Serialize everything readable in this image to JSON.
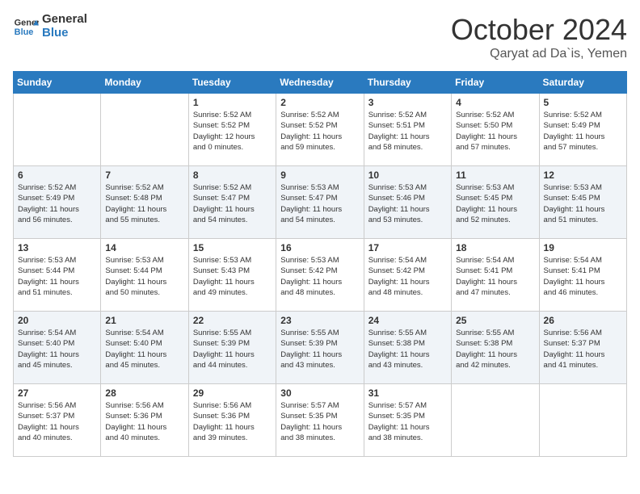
{
  "logo": {
    "line1": "General",
    "line2": "Blue"
  },
  "title": "October 2024",
  "location": "Qaryat ad Da`is, Yemen",
  "days_of_week": [
    "Sunday",
    "Monday",
    "Tuesday",
    "Wednesday",
    "Thursday",
    "Friday",
    "Saturday"
  ],
  "weeks": [
    [
      {
        "day": "",
        "info": ""
      },
      {
        "day": "",
        "info": ""
      },
      {
        "day": "1",
        "info": "Sunrise: 5:52 AM\nSunset: 5:52 PM\nDaylight: 12 hours\nand 0 minutes."
      },
      {
        "day": "2",
        "info": "Sunrise: 5:52 AM\nSunset: 5:52 PM\nDaylight: 11 hours\nand 59 minutes."
      },
      {
        "day": "3",
        "info": "Sunrise: 5:52 AM\nSunset: 5:51 PM\nDaylight: 11 hours\nand 58 minutes."
      },
      {
        "day": "4",
        "info": "Sunrise: 5:52 AM\nSunset: 5:50 PM\nDaylight: 11 hours\nand 57 minutes."
      },
      {
        "day": "5",
        "info": "Sunrise: 5:52 AM\nSunset: 5:49 PM\nDaylight: 11 hours\nand 57 minutes."
      }
    ],
    [
      {
        "day": "6",
        "info": "Sunrise: 5:52 AM\nSunset: 5:49 PM\nDaylight: 11 hours\nand 56 minutes."
      },
      {
        "day": "7",
        "info": "Sunrise: 5:52 AM\nSunset: 5:48 PM\nDaylight: 11 hours\nand 55 minutes."
      },
      {
        "day": "8",
        "info": "Sunrise: 5:52 AM\nSunset: 5:47 PM\nDaylight: 11 hours\nand 54 minutes."
      },
      {
        "day": "9",
        "info": "Sunrise: 5:53 AM\nSunset: 5:47 PM\nDaylight: 11 hours\nand 54 minutes."
      },
      {
        "day": "10",
        "info": "Sunrise: 5:53 AM\nSunset: 5:46 PM\nDaylight: 11 hours\nand 53 minutes."
      },
      {
        "day": "11",
        "info": "Sunrise: 5:53 AM\nSunset: 5:45 PM\nDaylight: 11 hours\nand 52 minutes."
      },
      {
        "day": "12",
        "info": "Sunrise: 5:53 AM\nSunset: 5:45 PM\nDaylight: 11 hours\nand 51 minutes."
      }
    ],
    [
      {
        "day": "13",
        "info": "Sunrise: 5:53 AM\nSunset: 5:44 PM\nDaylight: 11 hours\nand 51 minutes."
      },
      {
        "day": "14",
        "info": "Sunrise: 5:53 AM\nSunset: 5:44 PM\nDaylight: 11 hours\nand 50 minutes."
      },
      {
        "day": "15",
        "info": "Sunrise: 5:53 AM\nSunset: 5:43 PM\nDaylight: 11 hours\nand 49 minutes."
      },
      {
        "day": "16",
        "info": "Sunrise: 5:53 AM\nSunset: 5:42 PM\nDaylight: 11 hours\nand 48 minutes."
      },
      {
        "day": "17",
        "info": "Sunrise: 5:54 AM\nSunset: 5:42 PM\nDaylight: 11 hours\nand 48 minutes."
      },
      {
        "day": "18",
        "info": "Sunrise: 5:54 AM\nSunset: 5:41 PM\nDaylight: 11 hours\nand 47 minutes."
      },
      {
        "day": "19",
        "info": "Sunrise: 5:54 AM\nSunset: 5:41 PM\nDaylight: 11 hours\nand 46 minutes."
      }
    ],
    [
      {
        "day": "20",
        "info": "Sunrise: 5:54 AM\nSunset: 5:40 PM\nDaylight: 11 hours\nand 45 minutes."
      },
      {
        "day": "21",
        "info": "Sunrise: 5:54 AM\nSunset: 5:40 PM\nDaylight: 11 hours\nand 45 minutes."
      },
      {
        "day": "22",
        "info": "Sunrise: 5:55 AM\nSunset: 5:39 PM\nDaylight: 11 hours\nand 44 minutes."
      },
      {
        "day": "23",
        "info": "Sunrise: 5:55 AM\nSunset: 5:39 PM\nDaylight: 11 hours\nand 43 minutes."
      },
      {
        "day": "24",
        "info": "Sunrise: 5:55 AM\nSunset: 5:38 PM\nDaylight: 11 hours\nand 43 minutes."
      },
      {
        "day": "25",
        "info": "Sunrise: 5:55 AM\nSunset: 5:38 PM\nDaylight: 11 hours\nand 42 minutes."
      },
      {
        "day": "26",
        "info": "Sunrise: 5:56 AM\nSunset: 5:37 PM\nDaylight: 11 hours\nand 41 minutes."
      }
    ],
    [
      {
        "day": "27",
        "info": "Sunrise: 5:56 AM\nSunset: 5:37 PM\nDaylight: 11 hours\nand 40 minutes."
      },
      {
        "day": "28",
        "info": "Sunrise: 5:56 AM\nSunset: 5:36 PM\nDaylight: 11 hours\nand 40 minutes."
      },
      {
        "day": "29",
        "info": "Sunrise: 5:56 AM\nSunset: 5:36 PM\nDaylight: 11 hours\nand 39 minutes."
      },
      {
        "day": "30",
        "info": "Sunrise: 5:57 AM\nSunset: 5:35 PM\nDaylight: 11 hours\nand 38 minutes."
      },
      {
        "day": "31",
        "info": "Sunrise: 5:57 AM\nSunset: 5:35 PM\nDaylight: 11 hours\nand 38 minutes."
      },
      {
        "day": "",
        "info": ""
      },
      {
        "day": "",
        "info": ""
      }
    ]
  ]
}
